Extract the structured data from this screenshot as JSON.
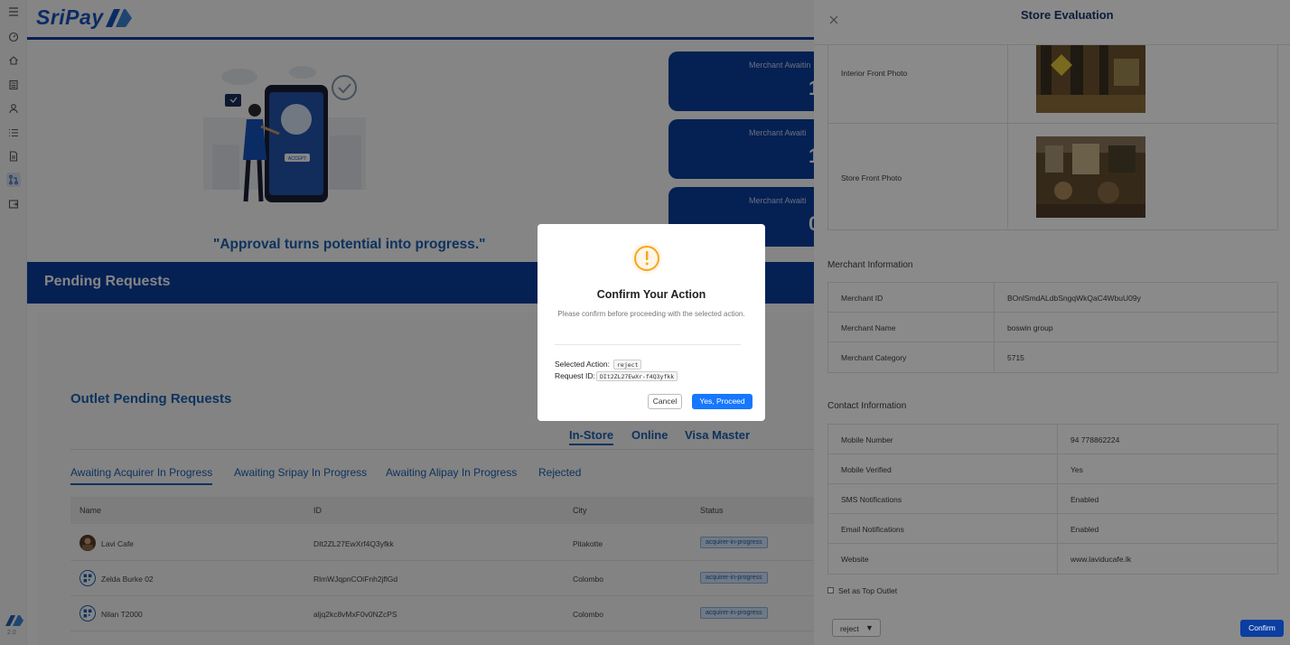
{
  "app": {
    "brand": "SriPay",
    "version": "2.0",
    "sidebar_icons": [
      "menu-icon",
      "dashboard-icon",
      "home-icon",
      "calculator-icon",
      "user-icon",
      "list-icon",
      "document-icon",
      "pull-request-icon",
      "export-icon"
    ]
  },
  "hero": {
    "quote": "\"Approval turns potential into progress.\"",
    "illustration_button": "ACCEPT"
  },
  "stats": [
    {
      "label": "Merchant Awaitin",
      "value": "1"
    },
    {
      "label": "Merchant Awaiti",
      "value": "1"
    },
    {
      "label": "Merchant Awaiti",
      "value": "0"
    }
  ],
  "pending": {
    "title": "Pending Requests"
  },
  "outlet": {
    "title": "Outlet Pending Requests",
    "channel_tabs": [
      "In-Store",
      "Online",
      "Visa Master"
    ],
    "status_tabs": [
      "Awaiting Acquirer In Progress",
      "Awaiting Sripay In Progress",
      "Awaiting Alipay In Progress",
      "Rejected"
    ],
    "columns": [
      "Name",
      "ID",
      "City",
      "Status"
    ],
    "rows": [
      {
        "name": "Lavi Cafe",
        "id": "DIt2ZL27EwXrf4Q3yfkk",
        "city": "Pitakotte",
        "status": "acquirer-in-progress"
      },
      {
        "name": "Zelda Burke 02",
        "id": "RlmWJqpnCOiFnh2jflGd",
        "city": "Colombo",
        "status": "acquirer-in-progress"
      },
      {
        "name": "Nilan T2000",
        "id": "aljq2kc8vMxF0v0NZcPS",
        "city": "Colombo",
        "status": "acquirer-in-progress"
      }
    ]
  },
  "drawer": {
    "title": "Store Evaluation",
    "photos": [
      {
        "label": "Interior Front Photo"
      },
      {
        "label": "Store Front Photo"
      }
    ],
    "merchant_section": "Merchant Information",
    "merchant": [
      {
        "k": "Merchant ID",
        "v": "BOnlSmdALdbSngqWkQaC4WbuU09y"
      },
      {
        "k": "Merchant Name",
        "v": "boswin group"
      },
      {
        "k": "Merchant Category",
        "v": "5715"
      }
    ],
    "contact_section": "Contact Information",
    "contact": [
      {
        "k": "Mobile Number",
        "v": "94 778862224"
      },
      {
        "k": "Mobile Verified",
        "v": "Yes"
      },
      {
        "k": "SMS Notifications",
        "v": "Enabled"
      },
      {
        "k": "Email Notifications",
        "v": "Enabled"
      },
      {
        "k": "Website",
        "v": "www.laviducafe.lk"
      }
    ],
    "top_outlet_label": "Set as Top Outlet",
    "action_select": "reject",
    "confirm_label": "Confirm"
  },
  "modal": {
    "title": "Confirm Your Action",
    "description": "Please confirm before proceeding with the selected action.",
    "action_label": "Selected Action:",
    "action_value": "reject",
    "request_label": "Request ID:",
    "request_value": "DIt2ZL27EwXr-f4Q3yfkk",
    "cancel_label": "Cancel",
    "proceed_label": "Yes, Proceed"
  },
  "colors": {
    "brand_blue": "#0a3ea0",
    "link_blue": "#1b62b5",
    "primary_button": "#1677ff",
    "warning": "#f5a623"
  }
}
